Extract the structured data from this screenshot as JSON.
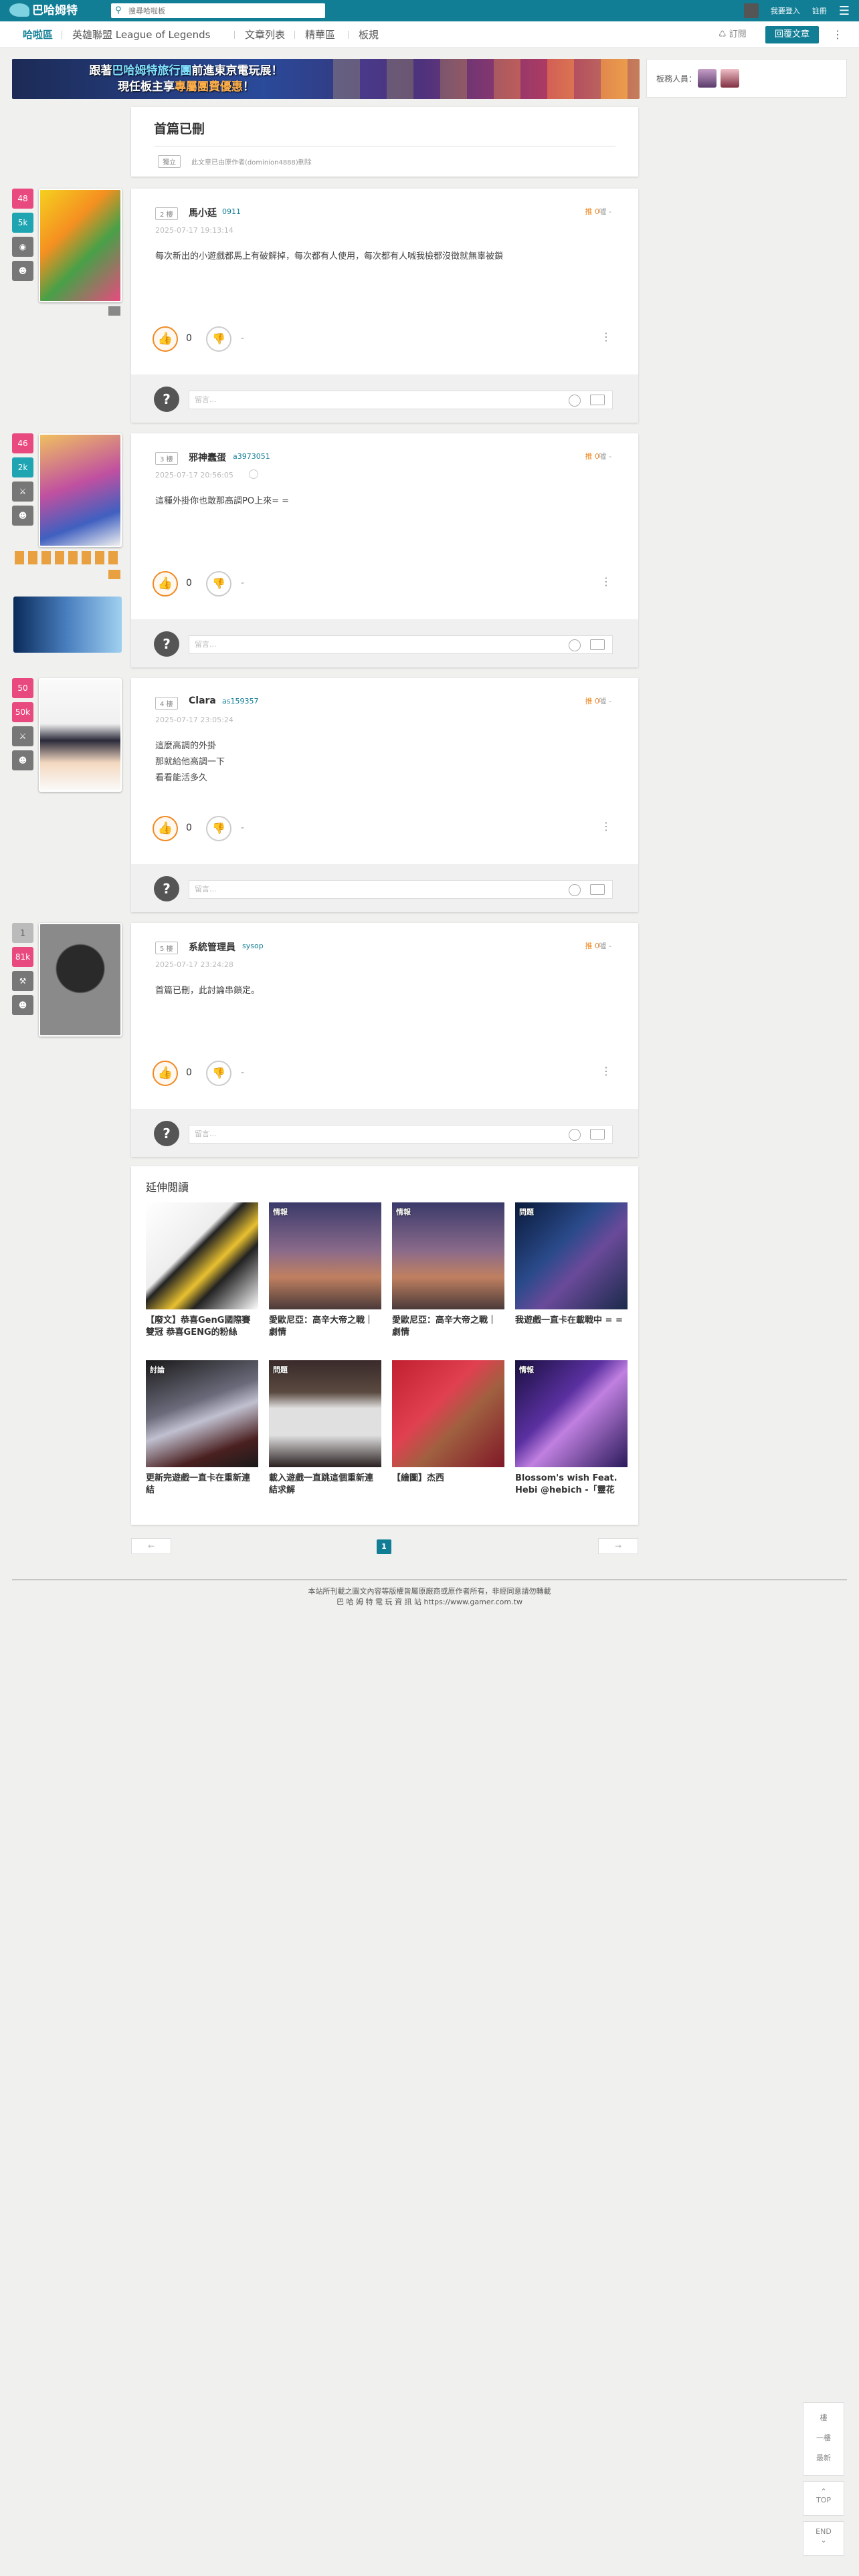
{
  "topbar": {
    "logo": "巴哈姆特",
    "search_placeholder": "搜尋哈啦板",
    "login": "我要登入",
    "register": "註冊"
  },
  "subnav": {
    "items": [
      "哈啦區",
      "英雄聯盟 League of Legends",
      "文章列表",
      "精華區",
      "板規"
    ],
    "subscribe": "訂閱",
    "reply": "回覆文章"
  },
  "banner": {
    "line1_a": "跟著",
    "line1_hl": "巴哈姆特旅行團",
    "line1_b": "前進東京電玩展！",
    "line2_a": "現任板主享",
    "line2_hl": "專屬團費優惠",
    "line2_b": "！"
  },
  "mods": {
    "label": "板務人員："
  },
  "thread": {
    "title": "首篇已刪",
    "tag": "獨立",
    "note": "此文章已由原作者(dominion4888)刪除"
  },
  "posts": [
    {
      "floor": "2 樓",
      "name": "馬小廷",
      "uid": "0911",
      "date": "2025-07-17 19:13:14",
      "gp_top": "推 0",
      "bp_top": "噓 -",
      "lines": [
        "每次新出的小遊戲都馬上有破解掉，每次都有人使用，每次都有人喊我檢都沒徵就無辜被鎖"
      ],
      "gp": "0",
      "bp": "-",
      "badges": [
        "48",
        "5k"
      ]
    },
    {
      "floor": "3 樓",
      "name": "邪神蠢蛋",
      "uid": "a3973051",
      "date": "2025-07-17 20:56:05",
      "gp_top": "推 0",
      "bp_top": "噓 -",
      "lines": [
        "這種外掛你也敢那高調PO上來= ="
      ],
      "gp": "0",
      "bp": "-",
      "badges": [
        "46",
        "2k"
      ]
    },
    {
      "floor": "4 樓",
      "name": "Clara",
      "uid": "as159357",
      "date": "2025-07-17 23:05:24",
      "gp_top": "推 0",
      "bp_top": "噓 -",
      "lines": [
        "這麼高調的外掛",
        "那就給他高調一下",
        "看看能活多久"
      ],
      "gp": "0",
      "bp": "-",
      "badges": [
        "50",
        "50k"
      ]
    },
    {
      "floor": "5 樓",
      "name": "系統管理員",
      "uid": "sysop",
      "date": "2025-07-17 23:24:28",
      "gp_top": "推 0",
      "bp_top": "噓 -",
      "lines": [
        "首篇已刪，此討論串鎖定。"
      ],
      "gp": "0",
      "bp": "-",
      "badges": [
        "1",
        "81k"
      ]
    }
  ],
  "comment": {
    "placeholder": "留言..."
  },
  "related": {
    "title": "延伸閱讀",
    "items": [
      {
        "tag": "",
        "caption": "【廢文】恭喜GenG國際賽雙冠 恭喜GENG的粉絲"
      },
      {
        "tag": "情報",
        "caption": "愛歐尼亞：高辛大帝之戰｜劇情"
      },
      {
        "tag": "情報",
        "caption": "愛歐尼亞：高辛大帝之戰｜劇情"
      },
      {
        "tag": "問題",
        "caption": "我遊戲一直卡在載戰中 = ="
      },
      {
        "tag": "討論",
        "caption": "更新完遊戲一直卡在重新連結"
      },
      {
        "tag": "問題",
        "caption": "載入遊戲一直跳這個重新連結求解"
      },
      {
        "tag": "",
        "caption": "【繪圖】杰西"
      },
      {
        "tag": "情報",
        "caption": "Blossom's wish Feat. Hebi @hebich -「靈花"
      }
    ]
  },
  "pager": {
    "prev": "←",
    "current": "1",
    "next": "→"
  },
  "footer": {
    "line1": "本站所刊載之圖文內容等版權皆屬原廠商或原作者所有，非經同意請勿轉載",
    "line2": "巴 哈 姆 特 電 玩 資 訊 站 https://www.gamer.com.tw"
  },
  "float": {
    "f1": "樓",
    "f2": "一樓",
    "f3": "最新",
    "top": "TOP",
    "end": "END"
  }
}
